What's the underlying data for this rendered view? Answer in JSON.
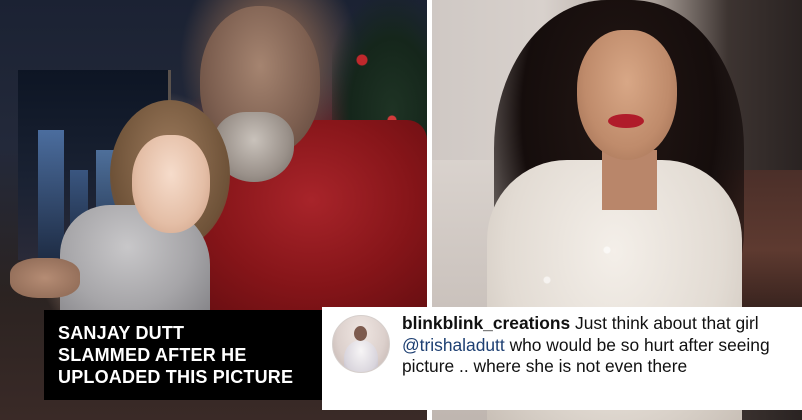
{
  "headline": {
    "lines": [
      "SANJAY DUTT",
      "SLAMMED AFTER HE",
      "UPLOADED THIS PICTURE"
    ]
  },
  "comment": {
    "username": "blinkblink_creations",
    "text_before_mention": " Just think about that girl ",
    "mention": "@trishaladutt",
    "text_after_mention": " who would be so hurt after seeing picture .. where she is not even there"
  },
  "colors": {
    "headline_bg": "#000000",
    "headline_text": "#ffffff",
    "comment_bg": "#ffffff",
    "comment_text": "#111111",
    "mention": "#1d3f72"
  }
}
